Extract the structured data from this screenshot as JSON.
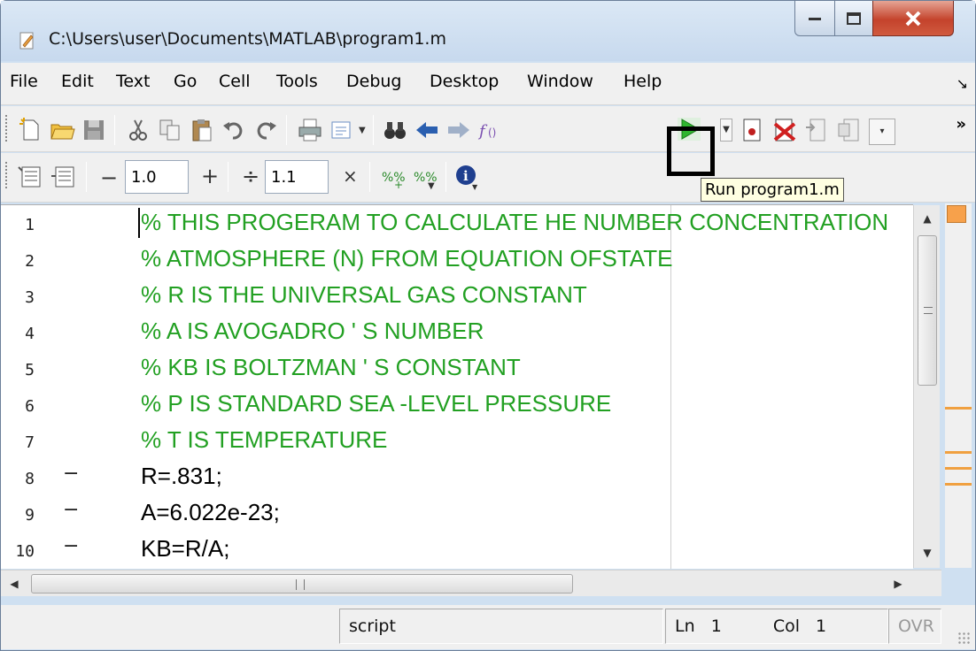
{
  "window": {
    "title": "C:\\Users\\user\\Documents\\MATLAB\\program1.m"
  },
  "menu": [
    "File",
    "Edit",
    "Text",
    "Go",
    "Cell",
    "Tools",
    "Debug",
    "Desktop",
    "Window",
    "Help"
  ],
  "toolbar2": {
    "cell_decrement": "1.0",
    "cell_divide": "1.1"
  },
  "tooltip": "Run program1.m",
  "editor": {
    "lines": [
      {
        "n": "1",
        "text": "% THIS PROGERAM TO CALCULATE HE NUMBER CONCENTRATION",
        "type": "comment",
        "marker": ""
      },
      {
        "n": "2",
        "text": "% ATMOSPHERE (N) FROM EQUATION OFSTATE",
        "type": "comment",
        "marker": ""
      },
      {
        "n": "3",
        "text": "% R IS THE UNIVERSAL GAS CONSTANT",
        "type": "comment",
        "marker": ""
      },
      {
        "n": "4",
        "text": "% A IS AVOGADRO ' S NUMBER",
        "type": "comment",
        "marker": ""
      },
      {
        "n": "5",
        "text": "% KB IS BOLTZMAN ' S CONSTANT",
        "type": "comment",
        "marker": ""
      },
      {
        "n": "6",
        "text": "% P IS STANDARD SEA -LEVEL PRESSURE",
        "type": "comment",
        "marker": ""
      },
      {
        "n": "7",
        "text": "% T IS TEMPERATURE",
        "type": "comment",
        "marker": ""
      },
      {
        "n": "8",
        "text": "R=.831;",
        "type": "stmt",
        "marker": "−"
      },
      {
        "n": "9",
        "text": "A=6.022e-23;",
        "type": "stmt",
        "marker": "−"
      },
      {
        "n": "10",
        "text": "KB=R/A;",
        "type": "stmt",
        "marker": "−"
      }
    ]
  },
  "status": {
    "mode": "script",
    "ln_label": "Ln",
    "ln_value": "1",
    "col_label": "Col",
    "col_value": "1",
    "ovr": "OVR"
  },
  "colors": {
    "comment": "#22a022",
    "run_green": "#2fb52f",
    "accent_orange": "#f0a040"
  }
}
